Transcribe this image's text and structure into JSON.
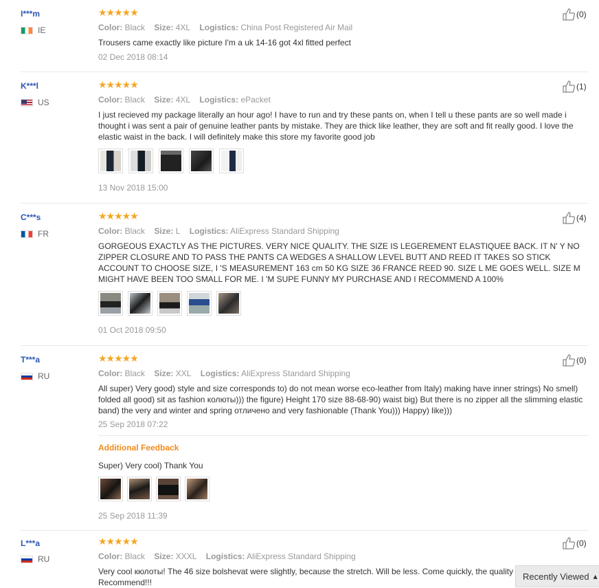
{
  "labels": {
    "color": "Color:",
    "size": "Size:",
    "logistics": "Logistics:",
    "additional_feedback": "Additional Feedback"
  },
  "rating_stars": "★★★★★",
  "reviews": [
    {
      "user": "I***m",
      "country": "IE",
      "rating": 5,
      "color": "Black",
      "size": "4XL",
      "logistics": "China Post Registered Air Mail",
      "text": "Trousers came exactly like picture I'm a uk 14-16 got 4xl fitted perfect",
      "date": "02 Dec 2018 08:14",
      "likes": "(0)"
    },
    {
      "user": "K***l",
      "country": "US",
      "rating": 5,
      "color": "Black",
      "size": "4XL",
      "logistics": "ePacket",
      "text": "I just recieved my package literally an hour ago! I have to run and try these pants on, when I tell u these pants are so well made i thought i was sent a pair of genuine leather pants by mistake. They are thick like leather, they are soft and fit really good. I love the elastic waist in the back. I will definitely make this store my favorite good job",
      "date": "13 Nov 2018 15:00",
      "likes": "(1)"
    },
    {
      "user": "C***s",
      "country": "FR",
      "rating": 5,
      "color": "Black",
      "size": "L",
      "logistics": "AliExpress Standard Shipping",
      "text": "GORGEOUS EXACTLY AS THE PICTURES. VERY NICE QUALITY. THE SIZE IS LEGEREMENT ELASTIQUEE BACK. IT N' Y NO ZIPPER CLOSURE AND TO PASS THE PANTS CA WEDGES A SHALLOW LEVEL BUTT AND REED IT TAKES SO STICK ACCOUNT TO CHOOSE SIZE, I 'S MEASUREMENT 163 cm 50 KG SIZE 36 FRANCE REED 90. SIZE L ME GOES WELL. SIZE M MIGHT HAVE BEEN TOO SMALL FOR ME. I 'M SUPE FUNNY MY PURCHASE AND I RECOMMEND A 100%",
      "date": "01 Oct 2018 09:50",
      "likes": "(4)"
    },
    {
      "user": "T***a",
      "country": "RU",
      "rating": 5,
      "color": "Black",
      "size": "XXL",
      "logistics": "AliExpress Standard Shipping",
      "text": "All super) Very good) style and size corresponds to) do not mean worse eco-leather from Italy) making have inner strings) No smell) folded all good) sit as fashion колюты))) the figure) Height 170 size 88-68-90) waist big) But there is no zipper all the slimming elastic band) the very and winter and spring отличено and very fashionable (Thank You))) Happy) like)))",
      "date": "25 Sep 2018 07:22",
      "likes": "(0)",
      "additional_text": "Super) Very cool) Thank You",
      "additional_date": "25 Sep 2018 11:39"
    },
    {
      "user": "L***a",
      "country": "RU",
      "rating": 5,
      "color": "Black",
      "size": "XXXL",
      "logistics": "AliExpress Standard Shipping",
      "text": "Very cool кюлоты! The 46 size bolshevat were slightly, because the stretch. Will be less. Come quickly, the quality is good. Recommend!!!",
      "likes": "(0)"
    }
  ],
  "recently_viewed": "Recently Viewed",
  "icons": {
    "like": "thumbs-up-icon",
    "recent": "chevron-icon"
  },
  "colors": {
    "username": "#2b55b5",
    "star": "#f5a623",
    "additional_feedback": "#f08c1a",
    "muted": "#999999"
  }
}
